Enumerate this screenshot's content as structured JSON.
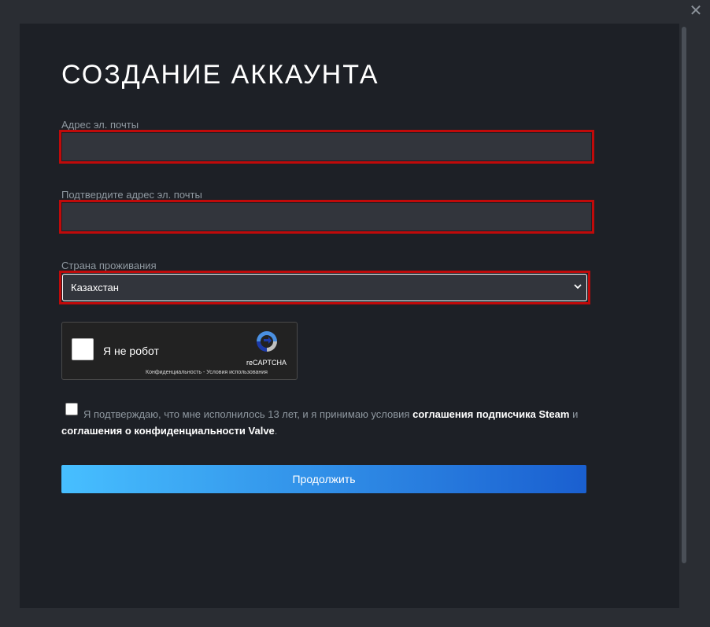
{
  "window": {
    "close_icon": "close-icon"
  },
  "page": {
    "title": "СОЗДАНИЕ АККАУНТА"
  },
  "form": {
    "email_label": "Адрес эл. почты",
    "email_value": "",
    "confirm_email_label": "Подтвердите адрес эл. почты",
    "confirm_email_value": "",
    "country_label": "Страна проживания",
    "country_selected": "Казахстан"
  },
  "recaptcha": {
    "label": "Я не робот",
    "brand": "reCAPTCHA",
    "links": "Конфиденциальность - Условия использования"
  },
  "agreement": {
    "text_1": "Я подтверждаю, что мне исполнилось 13 лет, и я принимаю условия ",
    "link_1": "соглашения подписчика Steam",
    "text_2": " и ",
    "link_2": "соглашения о конфиденциальности Valve",
    "text_3": "."
  },
  "actions": {
    "continue_label": "Продолжить"
  },
  "colors": {
    "error_border": "#c00a0a",
    "button_gradient_start": "#47bfff",
    "button_gradient_end": "#1a5fd0"
  }
}
